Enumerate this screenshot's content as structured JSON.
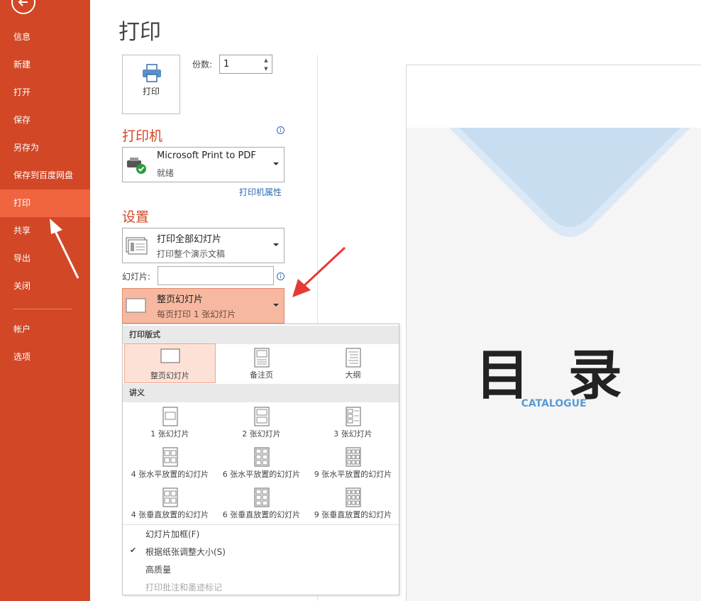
{
  "sidebar": {
    "items": [
      {
        "label": "信息"
      },
      {
        "label": "新建"
      },
      {
        "label": "打开"
      },
      {
        "label": "保存"
      },
      {
        "label": "另存为"
      },
      {
        "label": "保存到百度网盘"
      },
      {
        "label": "打印"
      },
      {
        "label": "共享"
      },
      {
        "label": "导出"
      },
      {
        "label": "关闭"
      },
      {
        "label": "帐户"
      },
      {
        "label": "选项"
      }
    ],
    "active": "打印",
    "bg_color": "#d24726",
    "active_color": "#f0653f"
  },
  "page": {
    "title": "打印"
  },
  "print": {
    "button_label": "打印",
    "copies_label": "份数:",
    "copies_value": "1"
  },
  "printer": {
    "heading": "打印机",
    "name": "Microsoft Print to PDF",
    "status": "就绪",
    "properties_link": "打印机属性"
  },
  "settings": {
    "heading": "设置",
    "range_title": "打印全部幻灯片",
    "range_desc": "打印整个演示文稿",
    "slides_label": "幻灯片:",
    "slides_value": "",
    "layout_title": "整页幻灯片",
    "layout_desc": "每页打印 1 张幻灯片"
  },
  "layout_menu": {
    "section_print_layout": "打印版式",
    "print_layouts": [
      "整页幻灯片",
      "备注页",
      "大纲"
    ],
    "section_handouts": "讲义",
    "handouts": [
      "1 张幻灯片",
      "2 张幻灯片",
      "3 张幻灯片",
      "4 张水平放置的幻灯片",
      "6 张水平放置的幻灯片",
      "9 张水平放置的幻灯片",
      "4 张垂直放置的幻灯片",
      "6 张垂直放置的幻灯片",
      "9 张垂直放置的幻灯片"
    ],
    "options": [
      {
        "label": "幻灯片加框(F)",
        "checked": false,
        "disabled": false
      },
      {
        "label": "根据纸张调整大小(S)",
        "checked": true,
        "disabled": false
      },
      {
        "label": "高质量",
        "checked": false,
        "disabled": false
      },
      {
        "label": "打印批注和墨迹标记",
        "checked": false,
        "disabled": true
      }
    ]
  },
  "preview": {
    "slide_title": "目 录",
    "slide_subtitle": "CATALOGUE"
  },
  "colors": {
    "accent": "#d24726",
    "link": "#2a6bb0",
    "subtitle": "#5b9bd5",
    "annotation": "#e53935"
  }
}
